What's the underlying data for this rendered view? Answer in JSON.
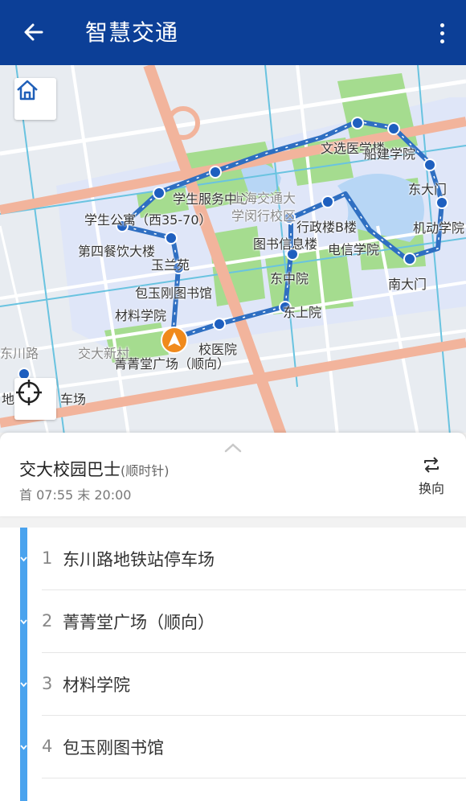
{
  "appbar": {
    "title": "智慧交通",
    "back_icon": "arrow-left-icon",
    "more_icon": "more-vertical-icon"
  },
  "colors": {
    "appbar": "#0c3f97",
    "route_line": "#2f6fc2",
    "stop_dot": "#1e5fbf",
    "rail": "#4aa3ee",
    "current_location": "#f08a1c"
  },
  "map": {
    "labels": {
      "wenxuan": "文选医学楼",
      "chuanjian": "船建学院",
      "dongdamen": "东大门",
      "jidong": "机动学院",
      "nandamen": "南大门",
      "dianxin": "电信学院",
      "xingzheng": "行政楼B楼",
      "tushu": "图书信息楼",
      "xuesheng_fuwu": "学生服务中心",
      "campus": "上海交通大学闵行校区",
      "xuesheng_gongyu": "学生公寓（西35-70）",
      "disi_canting": "第四餐饮大楼",
      "yulanyuan": "玉兰苑",
      "baoyugang": "包玉刚图书馆",
      "cailiao": "材料学院",
      "dongzhong": "东中院",
      "dongshang": "东上院",
      "xiaoyiyuan": "校医院",
      "jingjing": "菁菁堂广场（顺向）",
      "jiaoda_xincun": "交大新村",
      "dongchuan_lu": "东川路",
      "ditie_left": "地",
      "ditie_right": "车场"
    }
  },
  "route": {
    "name": "交大校园巴士",
    "direction": "(顺时针)",
    "schedule": "首 07:55 末 20:00",
    "switch_label": "换向"
  },
  "stops": [
    {
      "num": "1",
      "name": "东川路地铁站停车场"
    },
    {
      "num": "2",
      "name": "菁菁堂广场（顺向）"
    },
    {
      "num": "3",
      "name": "材料学院"
    },
    {
      "num": "4",
      "name": "包玉刚图书馆"
    }
  ]
}
